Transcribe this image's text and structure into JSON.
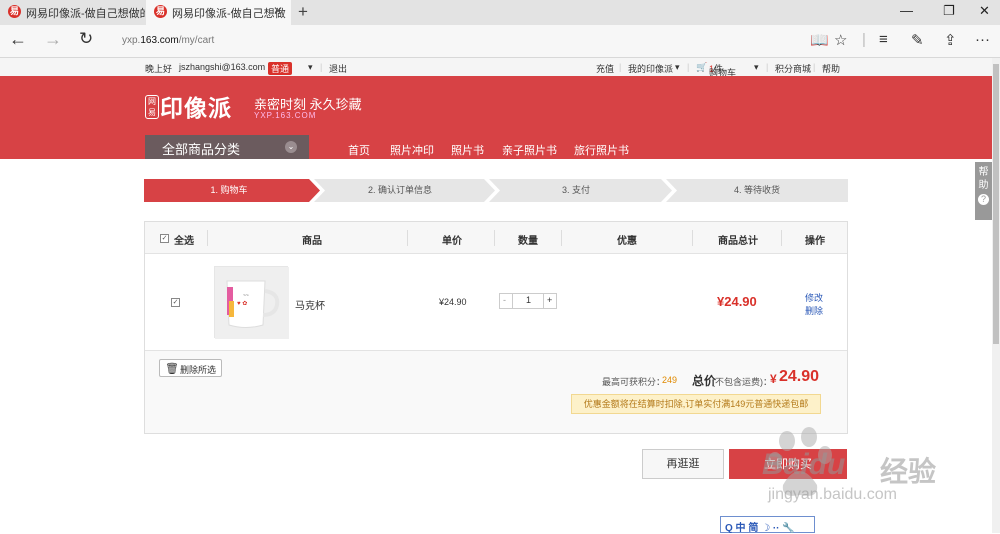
{
  "browser": {
    "tabs": [
      {
        "title": "网易印像派-做自己想做的与",
        "active": false
      },
      {
        "title": "网易印像派-做自己想做",
        "active": true
      }
    ],
    "url_prefix": "yxp.",
    "url_domain": "163.com",
    "url_path": "/my/cart"
  },
  "topbar": {
    "greeting": "晚上好",
    "email": "jszhangshi@163.com",
    "level": "普通",
    "logout": "退出",
    "recharge": "充值",
    "my_site": "我的印像派",
    "cart": "购物车",
    "cart_count": "1",
    "cart_unit": "件",
    "points_mall": "积分商城",
    "help": "帮助"
  },
  "header": {
    "logo_badge": "网易",
    "logo_text": "印像派",
    "slogan": "亲密时刻 永久珍藏",
    "domain": "YXP.163.COM",
    "category_button": "全部商品分类",
    "nav": [
      "首页",
      "照片冲印",
      "照片书",
      "亲子照片书",
      "旅行照片书"
    ]
  },
  "help_side": "帮助",
  "steps": [
    {
      "label": "1. 购物车",
      "active": true
    },
    {
      "label": "2. 确认订单信息",
      "active": false
    },
    {
      "label": "3. 支付",
      "active": false
    },
    {
      "label": "4. 等待收货",
      "active": false
    }
  ],
  "table": {
    "headers": {
      "select_all": "全选",
      "product": "商品",
      "unit_price": "单价",
      "quantity": "数量",
      "discount": "优惠",
      "subtotal": "商品总计",
      "actions": "操作"
    },
    "rows": [
      {
        "name": "马克杯",
        "price": "¥24.90",
        "quantity": "1",
        "discount": "",
        "subtotal": "¥24.90",
        "edit": "修改",
        "delete": "删除"
      }
    ]
  },
  "footer": {
    "delete_selected": "删除所选",
    "points_label": "最高可获积分：",
    "points_value": "249",
    "total_label": "总价",
    "total_note": "(不包含运费)：",
    "total_currency": "¥",
    "total_value": "24.90",
    "notice": "优惠金额将在结算时扣除,订单实付满149元普通快递包邮"
  },
  "buttons": {
    "continue": "再逛逛",
    "checkout": "立即购买"
  },
  "ime": {
    "text": "Q 中 简 ☽ ·· 🔧"
  },
  "watermark": {
    "brand": "Baidu",
    "brand_cn": "经验",
    "url": "jingyan.baidu.com"
  },
  "colors": {
    "brand_red": "#d74245",
    "link_blue": "#2a58b7",
    "price_red": "#d9312a",
    "points_orange": "#e08a00"
  }
}
